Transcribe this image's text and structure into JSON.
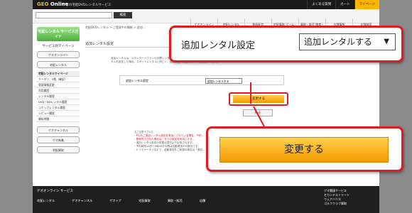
{
  "header": {
    "logo": "GEO Online",
    "tagline": "ゲオの宅配DVDレンタルサービス",
    "links": [
      "よくある質問",
      "カート",
      "マイページ"
    ],
    "search_button": "検索",
    "nav": [
      "ゲオオンライン TOP",
      "宅配レンタル",
      "動画配信",
      "宅配買取 ゲーム・DVD・CD",
      "買取・販売 携帯・スマートフォン",
      "店舗情報",
      "店舗検索"
    ]
  },
  "sidebar": {
    "brand": "宅配レンタル サービスガイド",
    "title": "サービス別マイページ",
    "buttons": [
      "ゲオオンライン",
      "宅配レンタル"
    ],
    "items": [
      "宅配レンタルマイページ",
      "クーポン：0枚（確認）",
      "登録情報変更",
      "利用履歴",
      "レンタル履歴",
      "DVD・BDレンタル履歴",
      "コミックレンタル履歴",
      "レビュー履歴",
      "貸料明細"
    ],
    "bottom_buttons": [
      "ゲオチャンネル",
      "ゲオ新着",
      "宅配買取"
    ]
  },
  "main": {
    "breadcrumb": "宅配DVDレンタル > ご登録中の情報 > 追加...",
    "page_title": "追加レンタル設定",
    "desc": "追加レンタルは、スタンダードプランの月間レンタル枚数を超えてレンタルする機能です。追加レンタル料金は1枚1泊ごとに600円です。※追加レンタルを設定した場合、スポットレンタルと同じく、延滞料金が発生しますのでご注意ください。",
    "setting_label": "追加レンタル設定",
    "setting_value": "追加レンタルする",
    "change_button": "変更する",
    "back_button": "戻る",
    "notes_title": "【ご注意下さい】",
    "notes": [
      "・PC/のご追加レンタル設定を有効にされている場合、予約...",
      "・登録完了された場合はこちらの設定を有効にする...",
      "・追加レンタル設定の変更は翌日より反映されます。",
      "・予約時刻10分〜9時40分の間は自動発送の対象外です。",
      "・ドコモケータイなどで、自動発送をご希望の場合は「追加..."
    ]
  },
  "footer": {
    "title": "ゲオオンライン サービス",
    "cols": [
      "宅配レンタル",
      "ゲオチャンネル",
      "ゲオトナ",
      "宅配買取",
      "買取・販売",
      "店舗"
    ],
    "right_title": "ゲオ関連サービス",
    "right_links": [
      "セカンドストリート",
      "ウェアハウス",
      "ゴルフクラブ買取"
    ]
  },
  "callouts": {
    "setting_label": "追加レンタル設定",
    "setting_value": "追加レンタルする",
    "change_button": "変更する"
  },
  "colors": {
    "accent": "#e21b23",
    "button": "#f29b00",
    "brand": "#4fae3e"
  }
}
